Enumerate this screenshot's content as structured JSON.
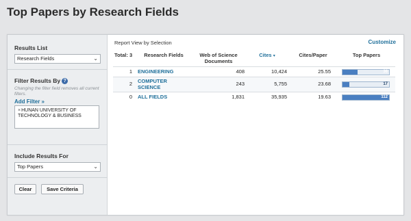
{
  "page": {
    "title": "Top Papers by Research Fields"
  },
  "sidebar": {
    "results_list": {
      "label": "Results List",
      "value": "Research Fields"
    },
    "filter": {
      "label": "Filter Results By",
      "help": "?",
      "hint": "Changing the filter field removes all current filters.",
      "add_filter": "Add Filter »",
      "remove": "×",
      "applied": "HUNAN UNIVERSITY OF TECHNOLOGY & BUSINESS"
    },
    "include": {
      "label": "Include Results For",
      "value": "Top Papers"
    },
    "buttons": {
      "clear": "Clear",
      "save": "Save Criteria"
    }
  },
  "main": {
    "report_view": "Report View by Selection",
    "customize": "Customize",
    "table": {
      "headers": {
        "total": "Total: 3",
        "field": "Research Fields",
        "docs": "Web of Science Documents",
        "cites": "Cites",
        "cites_sort": "▾",
        "cites_per_paper": "Cites/Paper",
        "top_papers": "Top Papers"
      },
      "rows": [
        {
          "rank": "1",
          "field": "ENGINEERING",
          "docs": "408",
          "cites": "10,424",
          "cites_per_paper": "25.55",
          "top_papers": "36",
          "top_frac": 0.32
        },
        {
          "rank": "2",
          "field": "COMPUTER SCIENCE",
          "docs": "243",
          "cites": "5,755",
          "cites_per_paper": "23.68",
          "top_papers": "17",
          "top_frac": 0.15
        },
        {
          "rank": "0",
          "field": "ALL FIELDS",
          "docs": "1,831",
          "cites": "35,935",
          "cites_per_paper": "19.63",
          "top_papers": "112",
          "top_frac": 1.0
        }
      ]
    }
  },
  "colors": {
    "link": "#1f6f9a",
    "bar": "#4a7fc1",
    "sidebar_bg": "#eceef0"
  }
}
